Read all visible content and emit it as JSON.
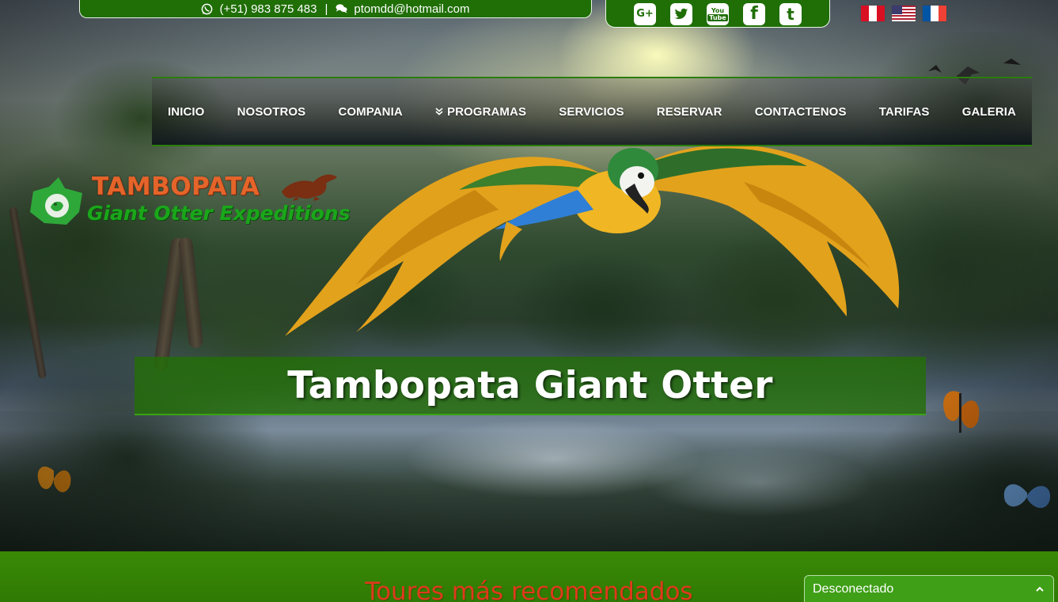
{
  "contact": {
    "phone": "(+51) 983 875 483",
    "separator": "|",
    "email": "ptomdd@hotmail.com"
  },
  "social": [
    {
      "name": "google-plus",
      "glyph": "G+"
    },
    {
      "name": "twitter",
      "glyph": "t"
    },
    {
      "name": "youtube",
      "glyph": "You Tube"
    },
    {
      "name": "facebook",
      "glyph": "f"
    },
    {
      "name": "tumblr",
      "glyph": "t"
    }
  ],
  "languages": [
    "peru",
    "usa",
    "france"
  ],
  "nav": {
    "items": [
      "INICIO",
      "NOSOTROS",
      "COMPANIA",
      "PROGRAMAS",
      "SERVICIOS",
      "RESERVAR",
      "CONTACTENOS",
      "TARIFAS",
      "GALERIA"
    ]
  },
  "logo": {
    "title": "TAMBOPATA",
    "subtitle": "Giant Otter Expeditions"
  },
  "hero": {
    "title": "Tambopata Giant Otter"
  },
  "section": {
    "title": "Toures más recomendados"
  },
  "chat": {
    "status": "Desconectado"
  },
  "colors": {
    "brand_green": "#1f6e06",
    "banner_green": "#236e08",
    "section_title": "#e0391b",
    "logo_orange": "#e5642a",
    "logo_green": "#1aa71a",
    "chat_green": "#3f9f17"
  }
}
